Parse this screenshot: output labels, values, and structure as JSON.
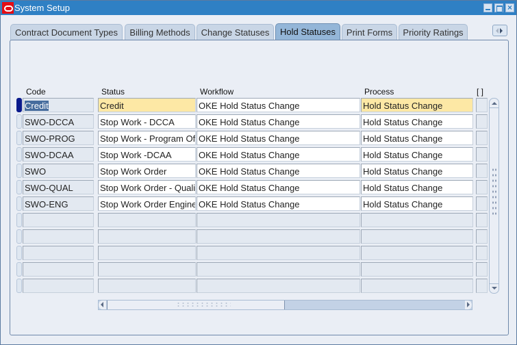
{
  "window": {
    "title": "System Setup",
    "controls": [
      "minimize",
      "maximize",
      "close"
    ]
  },
  "tabs": [
    {
      "label": "Contract Document Types",
      "active": false
    },
    {
      "label": "Billing Methods",
      "active": false
    },
    {
      "label": "Change Statuses",
      "active": false
    },
    {
      "label": "Hold Statuses",
      "active": true
    },
    {
      "label": "Print Forms",
      "active": false
    },
    {
      "label": "Priority Ratings",
      "active": false
    }
  ],
  "table": {
    "columns": [
      "Code",
      "Status",
      "Workflow",
      "Process",
      "[ ]"
    ],
    "rows": [
      {
        "code": "Credit",
        "status": "Credit",
        "workflow": "OKE Hold Status Change",
        "process": "Hold Status Change",
        "current": true
      },
      {
        "code": "SWO-DCCA",
        "status": "Stop Work - DCCA",
        "workflow": "OKE Hold Status Change",
        "process": "Hold Status Change"
      },
      {
        "code": "SWO-PROG",
        "status": "Stop Work - Program Office",
        "workflow": "OKE Hold Status Change",
        "process": "Hold Status Change"
      },
      {
        "code": "SWO-DCAA",
        "status": "Stop Work -DCAA",
        "workflow": "OKE Hold Status Change",
        "process": "Hold Status Change"
      },
      {
        "code": "SWO",
        "status": "Stop Work Order",
        "workflow": "OKE Hold Status Change",
        "process": "Hold Status Change"
      },
      {
        "code": "SWO-QUAL",
        "status": "Stop Work Order - Quality",
        "workflow": "OKE Hold Status Change",
        "process": "Hold Status Change"
      },
      {
        "code": "SWO-ENG",
        "status": "Stop Work Order Engineering",
        "workflow": "OKE Hold Status Change",
        "process": "Hold Status Change"
      }
    ],
    "empty_rows": 5
  },
  "colors": {
    "titlebar": "#2f80c4",
    "current_row_highlight": "#fde8a5",
    "current_record_indicator": "#0a1a8c",
    "active_tab": "#94b6d8"
  }
}
